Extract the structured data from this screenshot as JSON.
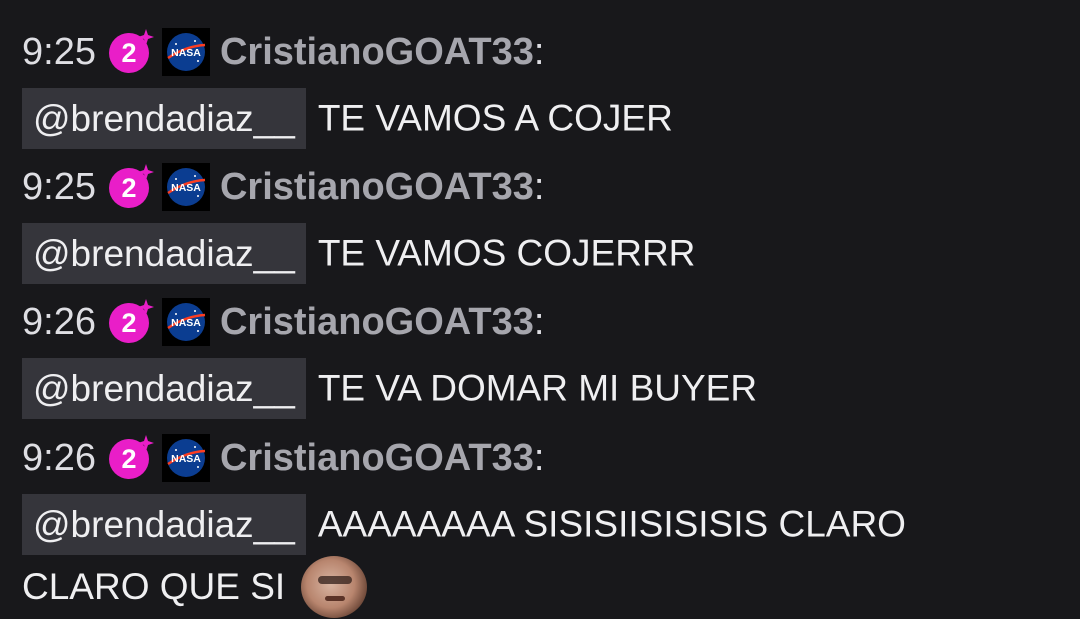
{
  "messages": [
    {
      "time": "9:25",
      "sub_badge": "2",
      "nasa_badge": "NASA",
      "username": "CristianoGOAT33",
      "colon": ":",
      "mention": "@brendadiaz__",
      "text": "TE VAMOS A COJER"
    },
    {
      "time": "9:25",
      "sub_badge": "2",
      "nasa_badge": "NASA",
      "username": "CristianoGOAT33",
      "colon": ":",
      "mention": "@brendadiaz__",
      "text": "TE VAMOS COJERRR"
    },
    {
      "time": "9:26",
      "sub_badge": "2",
      "nasa_badge": "NASA",
      "username": "CristianoGOAT33",
      "colon": ":",
      "mention": "@brendadiaz__",
      "text": "TE VA DOMAR MI BUYER"
    },
    {
      "time": "9:26",
      "sub_badge": "2",
      "nasa_badge": "NASA",
      "username": "CristianoGOAT33",
      "colon": ":",
      "mention": "@brendadiaz__",
      "text": "AAAAAAAA SISISIISISISIS CLARO",
      "text_line2": "CLARO QUE SI",
      "emote": "face-emote"
    }
  ],
  "colors": {
    "background": "#18181b",
    "username": "#a6a6ad",
    "mention_bg": "#35353b",
    "sub_badge": "#e91ec8"
  }
}
